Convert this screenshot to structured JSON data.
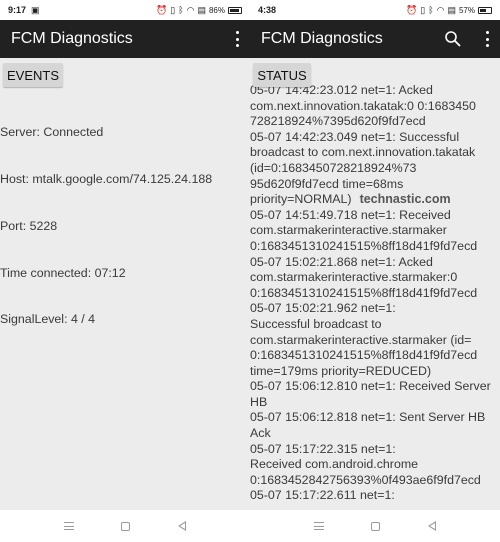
{
  "left": {
    "statusbar": {
      "time": "9:17",
      "battery": "86%",
      "battery_level": 0.86
    },
    "appbar": {
      "title": "FCM Diagnostics"
    },
    "tab": {
      "label": "EVENTS"
    },
    "lines": [
      "Server: Connected",
      "Host: mtalk.google.com/74.125.24.188",
      "Port: 5228",
      "Time connected: 07:12",
      "SignalLevel: 4 / 4"
    ]
  },
  "right": {
    "statusbar": {
      "time": "4:38",
      "battery": "57%",
      "battery_level": 0.57
    },
    "appbar": {
      "title": "FCM Diagnostics"
    },
    "tab": {
      "label": "STATUS"
    },
    "lines": [
      "05-07 14:42:23.012 net=1: Acked",
      "com.next.innovation.takatak:0 0:1683450",
      "728218924%7395d620f9fd7ecd",
      "05-07 14:42:23.049 net=1: Successful",
      "broadcast to com.next.innovation.takatak",
      "(id=0:1683450728218924%73",
      "95d620f9fd7ecd time=68ms",
      "priority=NORMAL)",
      "05-07 14:51:49.718 net=1: Received",
      "com.starmakerinteractive.starmaker",
      "0:1683451310241515%8ff18d41f9fd7ecd",
      "05-07 15:02:21.868 net=1: Acked",
      "com.starmakerinteractive.starmaker:0",
      "0:1683451310241515%8ff18d41f9fd7ecd",
      "05-07 15:02:21.962 net=1:",
      "Successful broadcast to",
      "com.starmakerinteractive.starmaker (id=",
      "0:1683451310241515%8ff18d41f9fd7ecd",
      "time=179ms priority=REDUCED)",
      "05-07 15:06:12.810 net=1: Received Server",
      "HB",
      "05-07 15:06:12.818 net=1: Sent Server HB",
      "Ack",
      "05-07 15:17:22.315 net=1:",
      "Received com.android.chrome",
      "0:1683452842756393%0f493ae6f9fd7ecd",
      "05-07 15:17:22.611 net=1:"
    ],
    "watermark": "technastic.com"
  }
}
